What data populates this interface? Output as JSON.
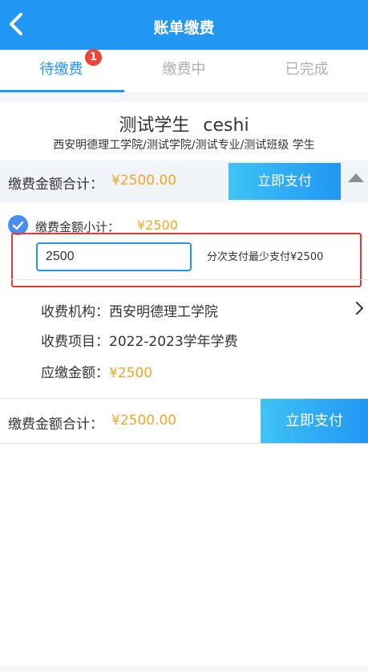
{
  "header": {
    "title": "账单缴费",
    "back_icon": "chevron-left-icon"
  },
  "tabs": [
    {
      "label": "待缴费",
      "active": true,
      "badge": "1"
    },
    {
      "label": "缴费中",
      "active": false
    },
    {
      "label": "已完成",
      "active": false
    }
  ],
  "student": {
    "name": "测试学生 ceshi",
    "path": "西安明德理工学院/测试学院/测试专业/测试班级 学生"
  },
  "summary": {
    "label": "缴费金额合计：",
    "amount": "¥2500.00",
    "pay_button": "立即支付",
    "collapse_icon": "triangle-up-icon"
  },
  "bill": {
    "checked": true,
    "subtotal_label": "缴费金额小计：",
    "subtotal_amount": "¥2500",
    "input_value": "2500",
    "min_note": "分次支付最少支付¥2500",
    "rows": [
      {
        "label": "收费机构：",
        "value": "西安明德理工学院"
      },
      {
        "label": "收费项目：",
        "value": "2022-2023学年学费"
      },
      {
        "label": "应缴金额：",
        "value": "¥2500"
      }
    ]
  },
  "footer": {
    "label": "缴费金额合计：",
    "amount": "¥2500.00",
    "pay_button": "立即支付"
  },
  "colors": {
    "primary": "#2196f3",
    "amount": "#f5a623",
    "badge": "#f44336",
    "highlight_box": "#e53935"
  }
}
